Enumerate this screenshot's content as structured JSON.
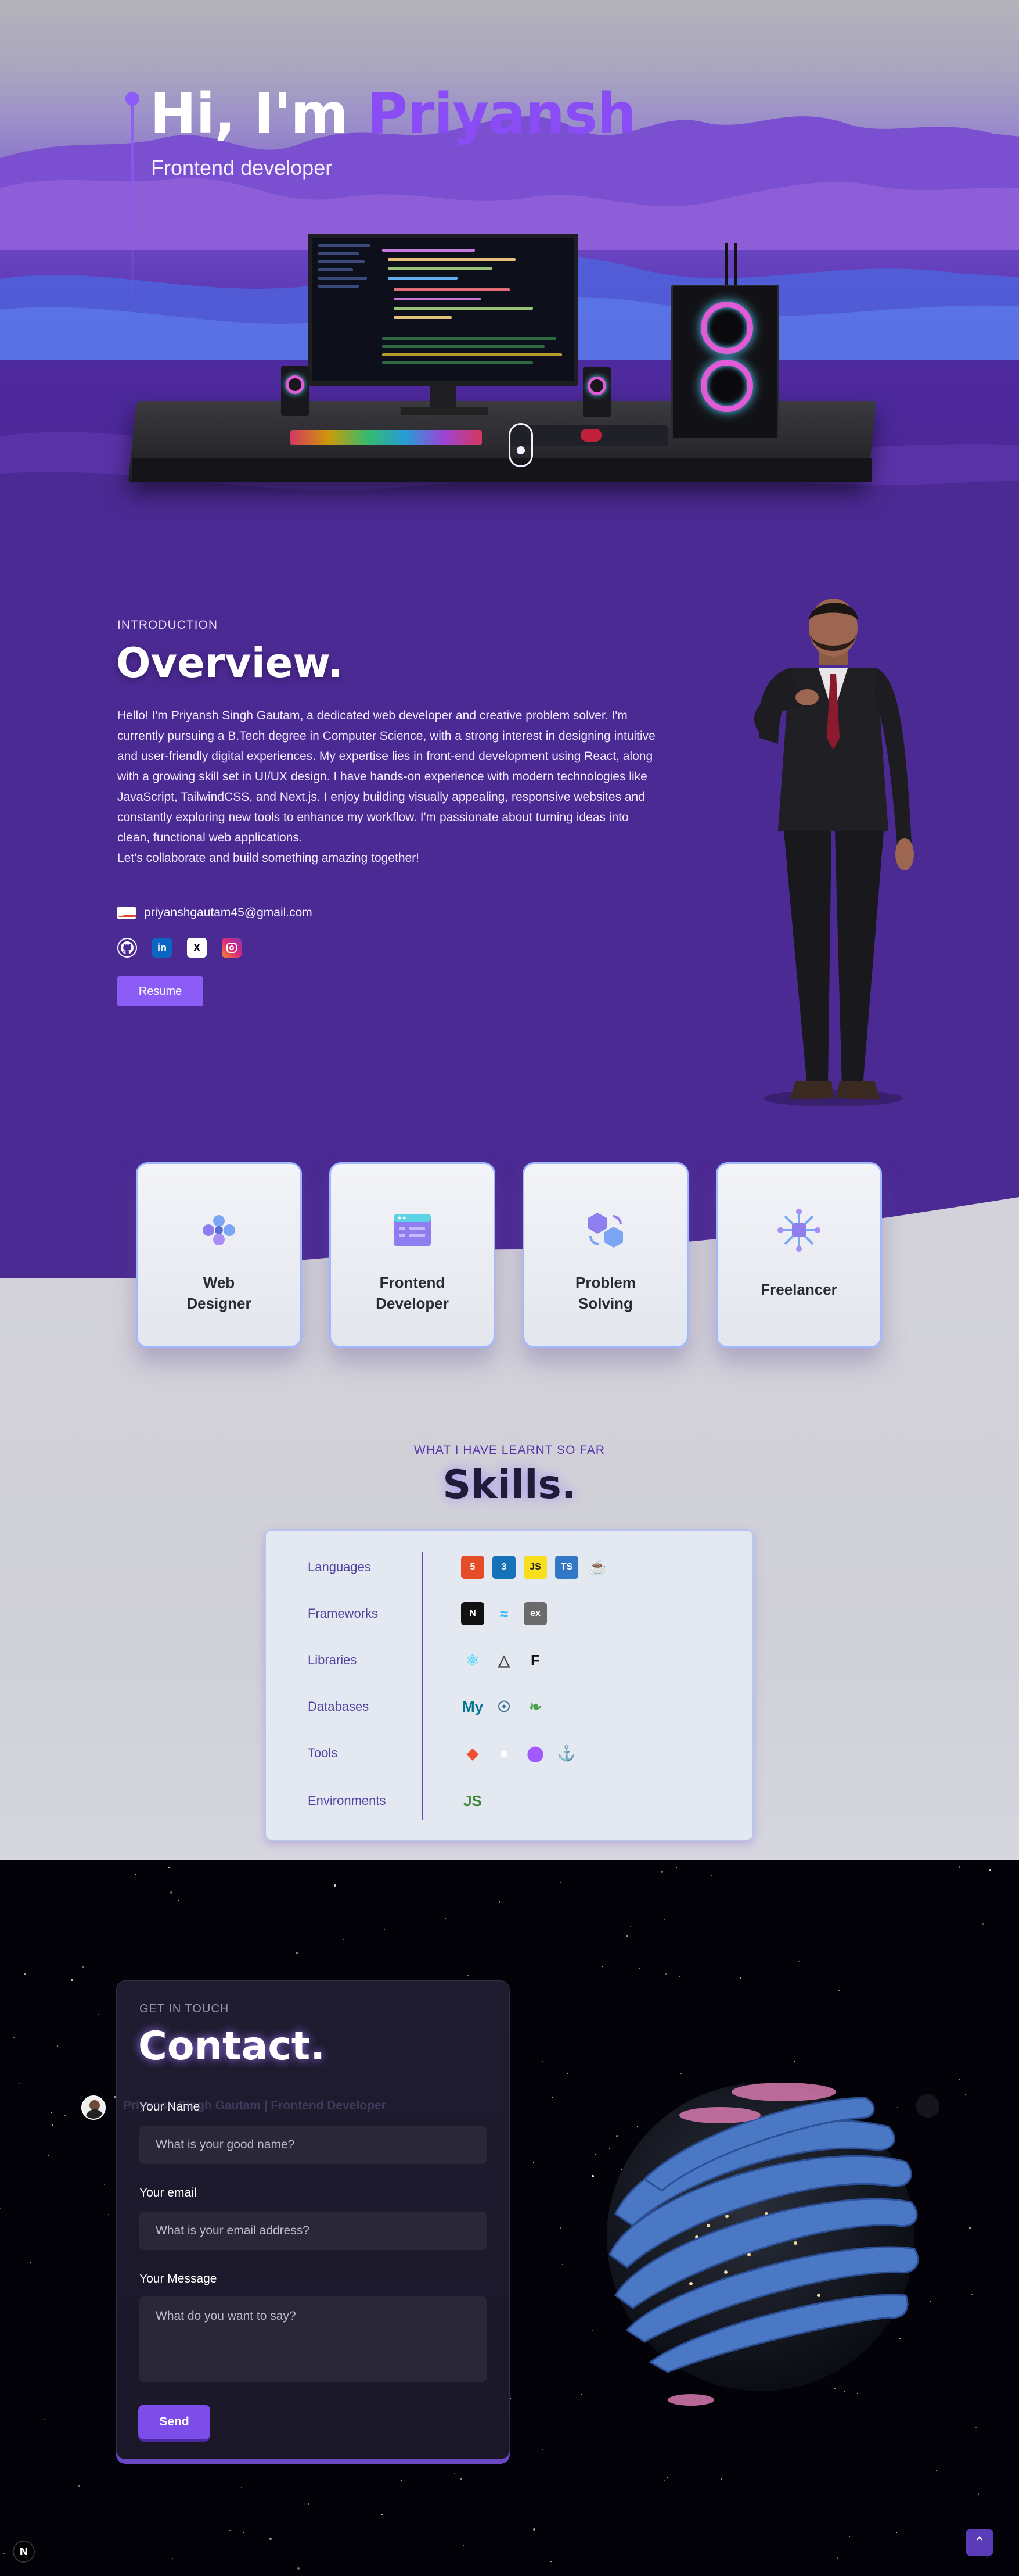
{
  "hero": {
    "greeting": "Hi, I'm",
    "name": "Priyansh",
    "subtitle": "Frontend developer"
  },
  "overview": {
    "tag": "INTRODUCTION",
    "title": "Overview.",
    "paragraph": "Hello! I'm Priyansh Singh Gautam, a dedicated web developer and creative problem solver. I'm currently pursuing a B.Tech degree in Computer Science, with a strong interest in designing intuitive and user-friendly digital experiences. My expertise lies in front-end development using React, along with a growing skill set in UI/UX design. I have hands-on experience with modern technologies like JavaScript, TailwindCSS, and Next.js. I enjoy building visually appealing, responsive websites and constantly exploring new tools to enhance my workflow. I'm passionate about turning ideas into clean, functional web applications.",
    "closing": "Let's collaborate and build something amazing together!",
    "email": "priyanshgautam45@gmail.com",
    "socials": [
      {
        "name": "github",
        "glyph": "●",
        "color": "#ffffff"
      },
      {
        "name": "linkedin",
        "glyph": "in",
        "color": "#0a66c2"
      },
      {
        "name": "x",
        "glyph": "X",
        "color": "#000000"
      },
      {
        "name": "instagram",
        "glyph": "◎",
        "color": "#e1306c"
      }
    ],
    "resume_label": "Resume"
  },
  "services": [
    {
      "line1": "Web",
      "line2": "Designer",
      "icon": "web-design-icon"
    },
    {
      "line1": "Frontend",
      "line2": "Developer",
      "icon": "browser-window-icon"
    },
    {
      "line1": "Problem",
      "line2": "Solving",
      "icon": "problem-solving-icon"
    },
    {
      "line1": "Freelancer",
      "line2": "",
      "icon": "freelancer-network-icon"
    }
  ],
  "skills": {
    "tag": "WHAT I HAVE LEARNT SO FAR",
    "title": "Skills.",
    "categories": [
      {
        "label": "Languages",
        "icons": [
          {
            "name": "html5-icon",
            "glyph": "5",
            "bg": "#e44d26",
            "fg": "#fff"
          },
          {
            "name": "css3-icon",
            "glyph": "3",
            "bg": "#1572b6",
            "fg": "#fff"
          },
          {
            "name": "javascript-icon",
            "glyph": "JS",
            "bg": "#f7df1e",
            "fg": "#222"
          },
          {
            "name": "typescript-icon",
            "glyph": "TS",
            "bg": "#3178c6",
            "fg": "#fff"
          },
          {
            "name": "java-icon",
            "glyph": "☕",
            "bg": "transparent",
            "fg": "#e76f00"
          }
        ]
      },
      {
        "label": "Frameworks",
        "icons": [
          {
            "name": "nextjs-icon",
            "glyph": "N",
            "bg": "#111",
            "fg": "#fff"
          },
          {
            "name": "tailwind-icon",
            "glyph": "≈",
            "bg": "transparent",
            "fg": "#38bdf8"
          },
          {
            "name": "express-icon",
            "glyph": "ex",
            "bg": "#6b6b6b",
            "fg": "#fff"
          }
        ]
      },
      {
        "label": "Libraries",
        "icons": [
          {
            "name": "react-icon",
            "glyph": "⚛",
            "bg": "transparent",
            "fg": "#61dafb"
          },
          {
            "name": "threejs-icon",
            "glyph": "△",
            "bg": "transparent",
            "fg": "#444"
          },
          {
            "name": "framer-motion-icon",
            "glyph": "F",
            "bg": "transparent",
            "fg": "#111"
          }
        ]
      },
      {
        "label": "Databases",
        "icons": [
          {
            "name": "mysql-icon",
            "glyph": "My",
            "bg": "transparent",
            "fg": "#00758f"
          },
          {
            "name": "postgresql-icon",
            "glyph": "☉",
            "bg": "transparent",
            "fg": "#336791"
          },
          {
            "name": "mongodb-icon",
            "glyph": "❧",
            "bg": "transparent",
            "fg": "#47a248"
          }
        ]
      },
      {
        "label": "Tools",
        "icons": [
          {
            "name": "git-icon",
            "glyph": "◆",
            "bg": "transparent",
            "fg": "#f05032"
          },
          {
            "name": "github-icon",
            "glyph": "●",
            "bg": "transparent",
            "fg": "#fff"
          },
          {
            "name": "figma-icon",
            "glyph": "⬤",
            "bg": "transparent",
            "fg": "#a259ff"
          },
          {
            "name": "docker-icon",
            "glyph": "⚓",
            "bg": "transparent",
            "fg": "#2496ed"
          }
        ]
      },
      {
        "label": "Environments",
        "icons": [
          {
            "name": "nodejs-icon",
            "glyph": "JS",
            "bg": "transparent",
            "fg": "#3c873a"
          }
        ]
      }
    ]
  },
  "contact": {
    "tag": "GET IN TOUCH",
    "title": "Contact.",
    "name_label": "Your Name",
    "name_placeholder": "What is your good name?",
    "email_label": "Your email",
    "email_placeholder": "What is your email address?",
    "message_label": "Your Message",
    "message_placeholder": "What do you want to say?",
    "send_label": "Send"
  },
  "navbar": {
    "brand": "Priyansh Singh Gautam | Frontend Developer"
  },
  "footer": {
    "back_to_top": "⌃",
    "n_logo": "N"
  }
}
